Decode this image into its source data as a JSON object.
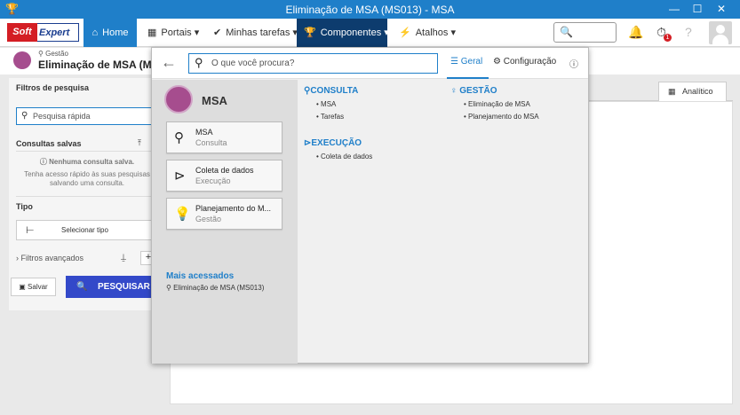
{
  "window": {
    "title": "Eliminação de MSA (MS013) - MSA",
    "min": "—",
    "max": "☐",
    "close": "✕"
  },
  "logo": {
    "soft": "Soft",
    "expert": "Expert"
  },
  "nav": {
    "home": "Home",
    "portais": "Portais ▾",
    "tarefas": "Minhas tarefas ▾",
    "componentes": "Componentes ▾",
    "atalhos": "Atalhos ▾"
  },
  "notify": {
    "badge": "1"
  },
  "page": {
    "crumb": "Gestão",
    "title": "Eliminação de MSA (MS01"
  },
  "filters": {
    "title": "Filtros de pesquisa",
    "quick_placeholder": "Pesquisa rápida",
    "saved_title": "Consultas salvas",
    "empty_1": "Nenhuma consulta salva.",
    "empty_2": "Tenha acesso rápido às suas pesquisas",
    "empty_3": "salvando uma consulta.",
    "tipo_title": "Tipo",
    "tipo_button": "Selecionar tipo",
    "advanced": "Filtros avançados",
    "save": "Salvar",
    "search": "PESQUISAR"
  },
  "content": {
    "tab": "Analítico"
  },
  "overlay": {
    "search_placeholder": "O que você procura?",
    "tab_geral": "Geral",
    "tab_config": "Configuração",
    "module": "MSA",
    "cards": [
      {
        "title": "MSA",
        "sub": "Consulta",
        "icon": "search-icon"
      },
      {
        "title": "Coleta de dados",
        "sub": "Execução",
        "icon": "play-icon"
      },
      {
        "title": "Planejamento do M...",
        "sub": "Gestão",
        "icon": "bulb-icon"
      }
    ],
    "mais_title": "Mais acessados",
    "mais_item": "Eliminação de MSA (MS013)",
    "consulta": {
      "title": "CONSULTA",
      "items": [
        "MSA",
        "Tarefas"
      ]
    },
    "execucao": {
      "title": "EXECUÇÃO",
      "items": [
        "Coleta de dados"
      ]
    },
    "gestao": {
      "title": "GESTÃO",
      "items": [
        "Eliminação de MSA",
        "Planejamento do MSA"
      ]
    }
  }
}
